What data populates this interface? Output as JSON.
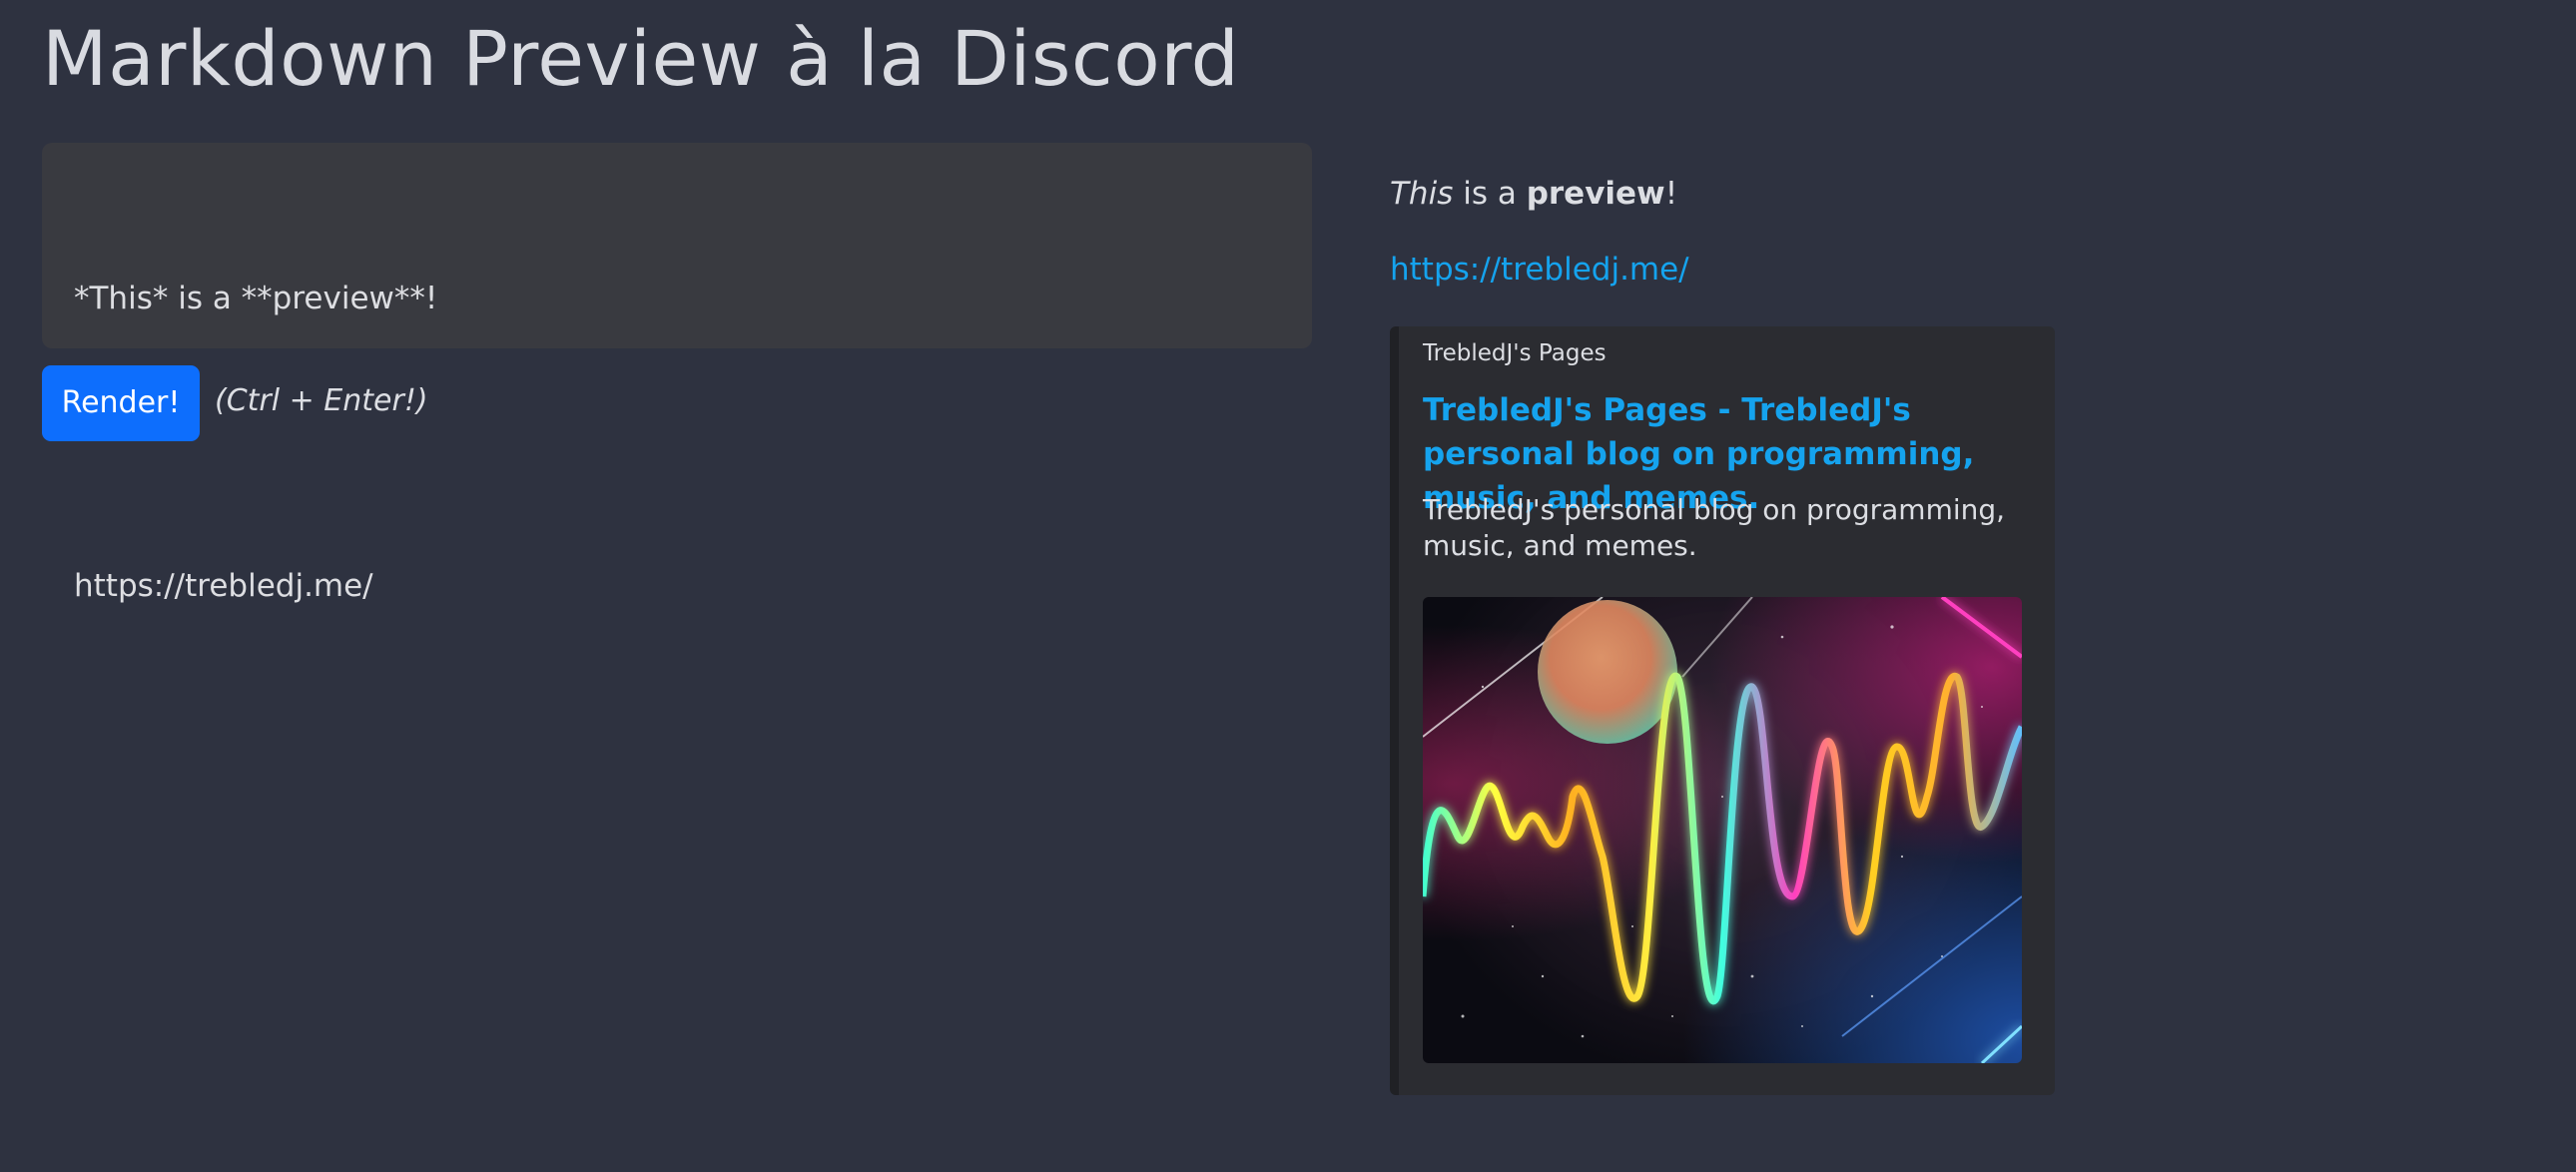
{
  "page": {
    "title": "Markdown Preview à la Discord"
  },
  "editor": {
    "lines": [
      "*This* is a **preview**!",
      "",
      "https://trebledj.me/"
    ]
  },
  "controls": {
    "render_label": "Render!",
    "shortcut_hint": "(Ctrl + Enter!)"
  },
  "preview": {
    "line1": {
      "italic": "This",
      "middle": " is a ",
      "bold": "preview",
      "end": "!"
    },
    "link": "https://trebledj.me/",
    "embed": {
      "provider": "TrebledJ's Pages",
      "title": "TrebledJ's Pages - TrebledJ's personal blog on programming, music, and memes.",
      "description": "TrebledJ's personal blog on programming, music, and memes.",
      "image_icon": "neon-sound-wave-image"
    }
  },
  "colors": {
    "background": "#2e3240",
    "editor_bg": "#393a40",
    "button": "#0d6efd",
    "link": "#15a3ee",
    "embed_bg": "#2b2c31"
  }
}
